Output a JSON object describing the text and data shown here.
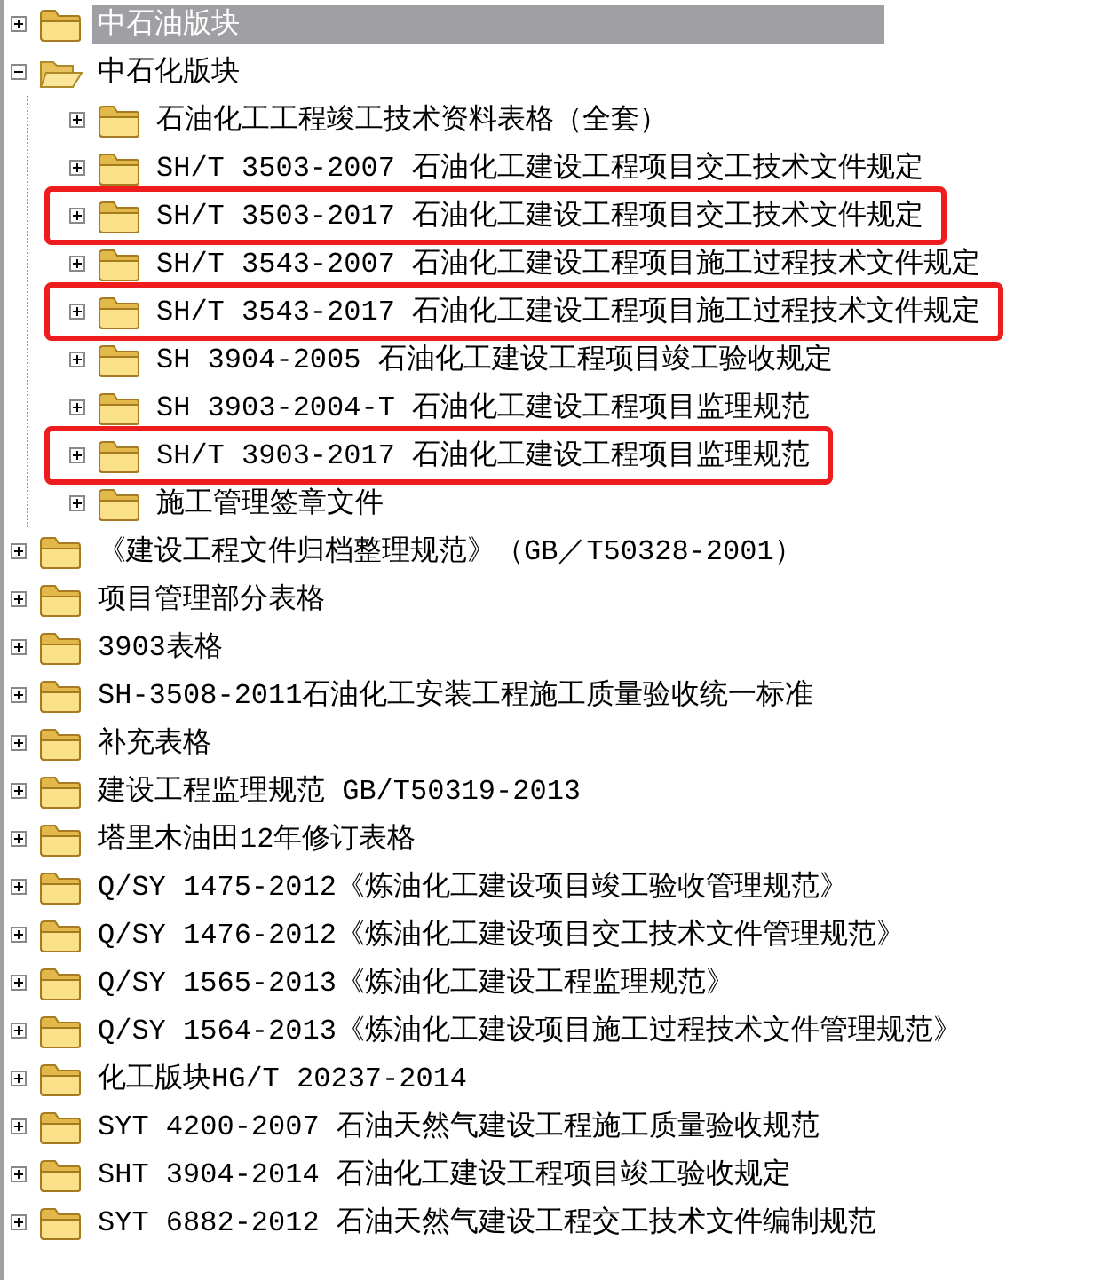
{
  "tree": [
    {
      "label": "中石油版块",
      "selected": true,
      "expanded": false
    },
    {
      "label": "中石化版块",
      "selected": false,
      "expanded": true,
      "children": [
        {
          "label": "石油化工工程竣工技术资料表格（全套）",
          "selected": false,
          "expanded": false,
          "highlighted": false
        },
        {
          "label": "SH/T 3503-2007 石油化工建设工程项目交工技术文件规定",
          "selected": false,
          "expanded": false,
          "highlighted": false
        },
        {
          "label": "SH/T 3503-2017 石油化工建设工程项目交工技术文件规定",
          "selected": false,
          "expanded": false,
          "highlighted": true
        },
        {
          "label": "SH/T 3543-2007 石油化工建设工程项目施工过程技术文件规定",
          "selected": false,
          "expanded": false,
          "highlighted": false
        },
        {
          "label": "SH/T 3543-2017 石油化工建设工程项目施工过程技术文件规定",
          "selected": false,
          "expanded": false,
          "highlighted": true
        },
        {
          "label": "SH 3904-2005 石油化工建设工程项目竣工验收规定",
          "selected": false,
          "expanded": false,
          "highlighted": false
        },
        {
          "label": "SH 3903-2004-T 石油化工建设工程项目监理规范",
          "selected": false,
          "expanded": false,
          "highlighted": false
        },
        {
          "label": "SH/T 3903-2017 石油化工建设工程项目监理规范",
          "selected": false,
          "expanded": false,
          "highlighted": true
        },
        {
          "label": "施工管理签章文件",
          "selected": false,
          "expanded": false,
          "highlighted": false
        }
      ]
    },
    {
      "label": "《建设工程文件归档整理规范》（GB／T50328-2001）",
      "selected": false,
      "expanded": false
    },
    {
      "label": "项目管理部分表格",
      "selected": false,
      "expanded": false
    },
    {
      "label": "3903表格",
      "selected": false,
      "expanded": false
    },
    {
      "label": "SH-3508-2011石油化工安装工程施工质量验收统一标准",
      "selected": false,
      "expanded": false
    },
    {
      "label": "补充表格",
      "selected": false,
      "expanded": false
    },
    {
      "label": "建设工程监理规范 GB/T50319-2013",
      "selected": false,
      "expanded": false
    },
    {
      "label": "塔里木油田12年修订表格",
      "selected": false,
      "expanded": false
    },
    {
      "label": "Q/SY 1475-2012《炼油化工建设项目竣工验收管理规范》",
      "selected": false,
      "expanded": false
    },
    {
      "label": "Q/SY 1476-2012《炼油化工建设项目交工技术文件管理规范》",
      "selected": false,
      "expanded": false
    },
    {
      "label": "Q/SY 1565-2013《炼油化工建设工程监理规范》",
      "selected": false,
      "expanded": false
    },
    {
      "label": "Q/SY 1564-2013《炼油化工建设项目施工过程技术文件管理规范》",
      "selected": false,
      "expanded": false
    },
    {
      "label": "化工版块HG/T 20237-2014",
      "selected": false,
      "expanded": false
    },
    {
      "label": "SYT 4200-2007 石油天然气建设工程施工质量验收规范",
      "selected": false,
      "expanded": false
    },
    {
      "label": "SHT 3904-2014 石油化工建设工程项目竣工验收规定",
      "selected": false,
      "expanded": false
    },
    {
      "label": "SYT 6882-2012 石油天然气建设工程交工技术文件编制规范",
      "selected": false,
      "expanded": false
    }
  ]
}
